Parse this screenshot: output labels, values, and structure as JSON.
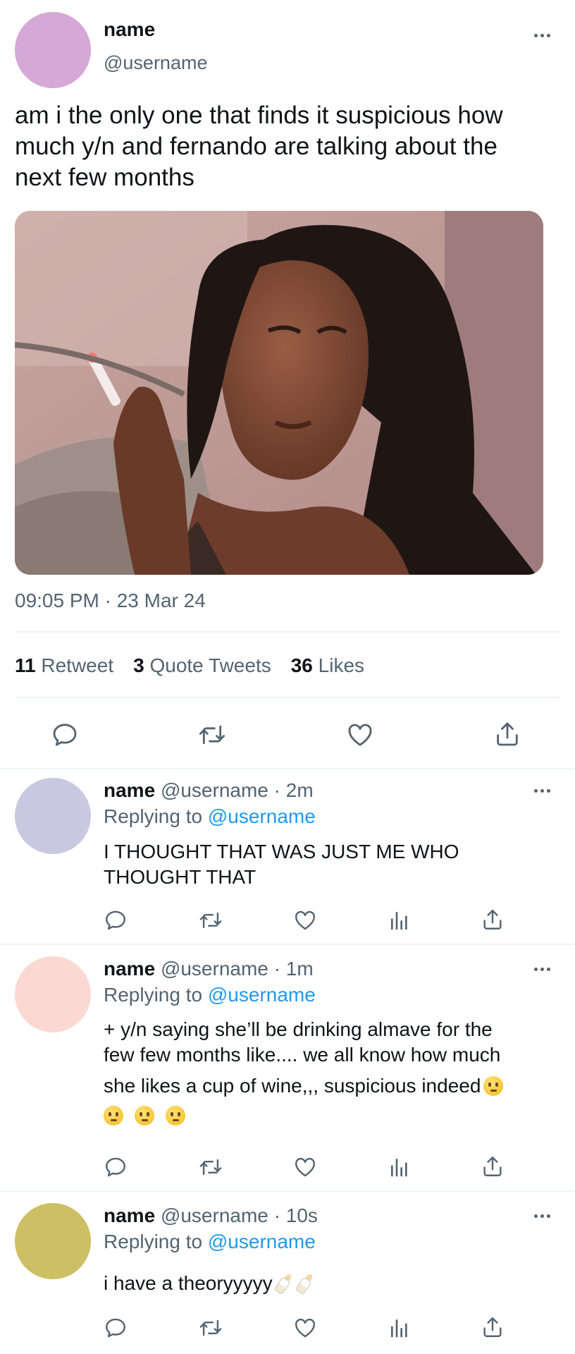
{
  "tweet": {
    "display_name": "name",
    "handle": "@username",
    "avatar_color": "#d6a8d6",
    "text": "am i the only one that finds it suspicious how much y/n and fernando are talking about the next few months",
    "image_alt": "meme photo of a woman holding a cigarette with a skeptical squint",
    "timestamp": "09:05 PM · 23 Mar 24",
    "stats": {
      "retweets_count": "11",
      "retweets_label": "Retweet",
      "quotes_count": "3",
      "quotes_label": "Quote Tweets",
      "likes_count": "36",
      "likes_label": "Likes"
    },
    "actions": [
      "reply-icon",
      "retweet-icon",
      "like-icon",
      "share-icon"
    ]
  },
  "replies": [
    {
      "display_name": "name",
      "handle": "@username",
      "time": "· 2m",
      "replying_prefix": "Replying to",
      "replying_to": "@username",
      "text_line1": "I THOUGHT THAT WAS JUST ME WHO",
      "text_line2": "THOUGHT THAT",
      "avatar_color": "#c9c8e0"
    },
    {
      "display_name": "name",
      "handle": "@username",
      "time": "· 1m",
      "replying_prefix": "Replying to",
      "replying_to": "@username",
      "text_line1": "+ y/n saying she’ll be drinking almave for the",
      "text_line2": "few few months like.... we all know how much",
      "text_line3": "she likes a cup of wine,,, suspicious indeed",
      "emojis": [
        "thinking-face",
        "thinking-face",
        "thinking-face",
        "thinking-face"
      ],
      "avatar_color": "#fbd9d2"
    },
    {
      "display_name": "name",
      "handle": "@username",
      "time": "· 10s",
      "replying_prefix": "Replying to",
      "replying_to": "@username",
      "text_line1": "i have a theoryyyyy",
      "emojis": [
        "baby-bottle",
        "baby-bottle"
      ],
      "avatar_color": "#cdbf63"
    }
  ],
  "colors": {
    "text": "#0f1419",
    "muted": "#536471",
    "accent": "#1d9bf0",
    "divider": "#eff3f4"
  }
}
